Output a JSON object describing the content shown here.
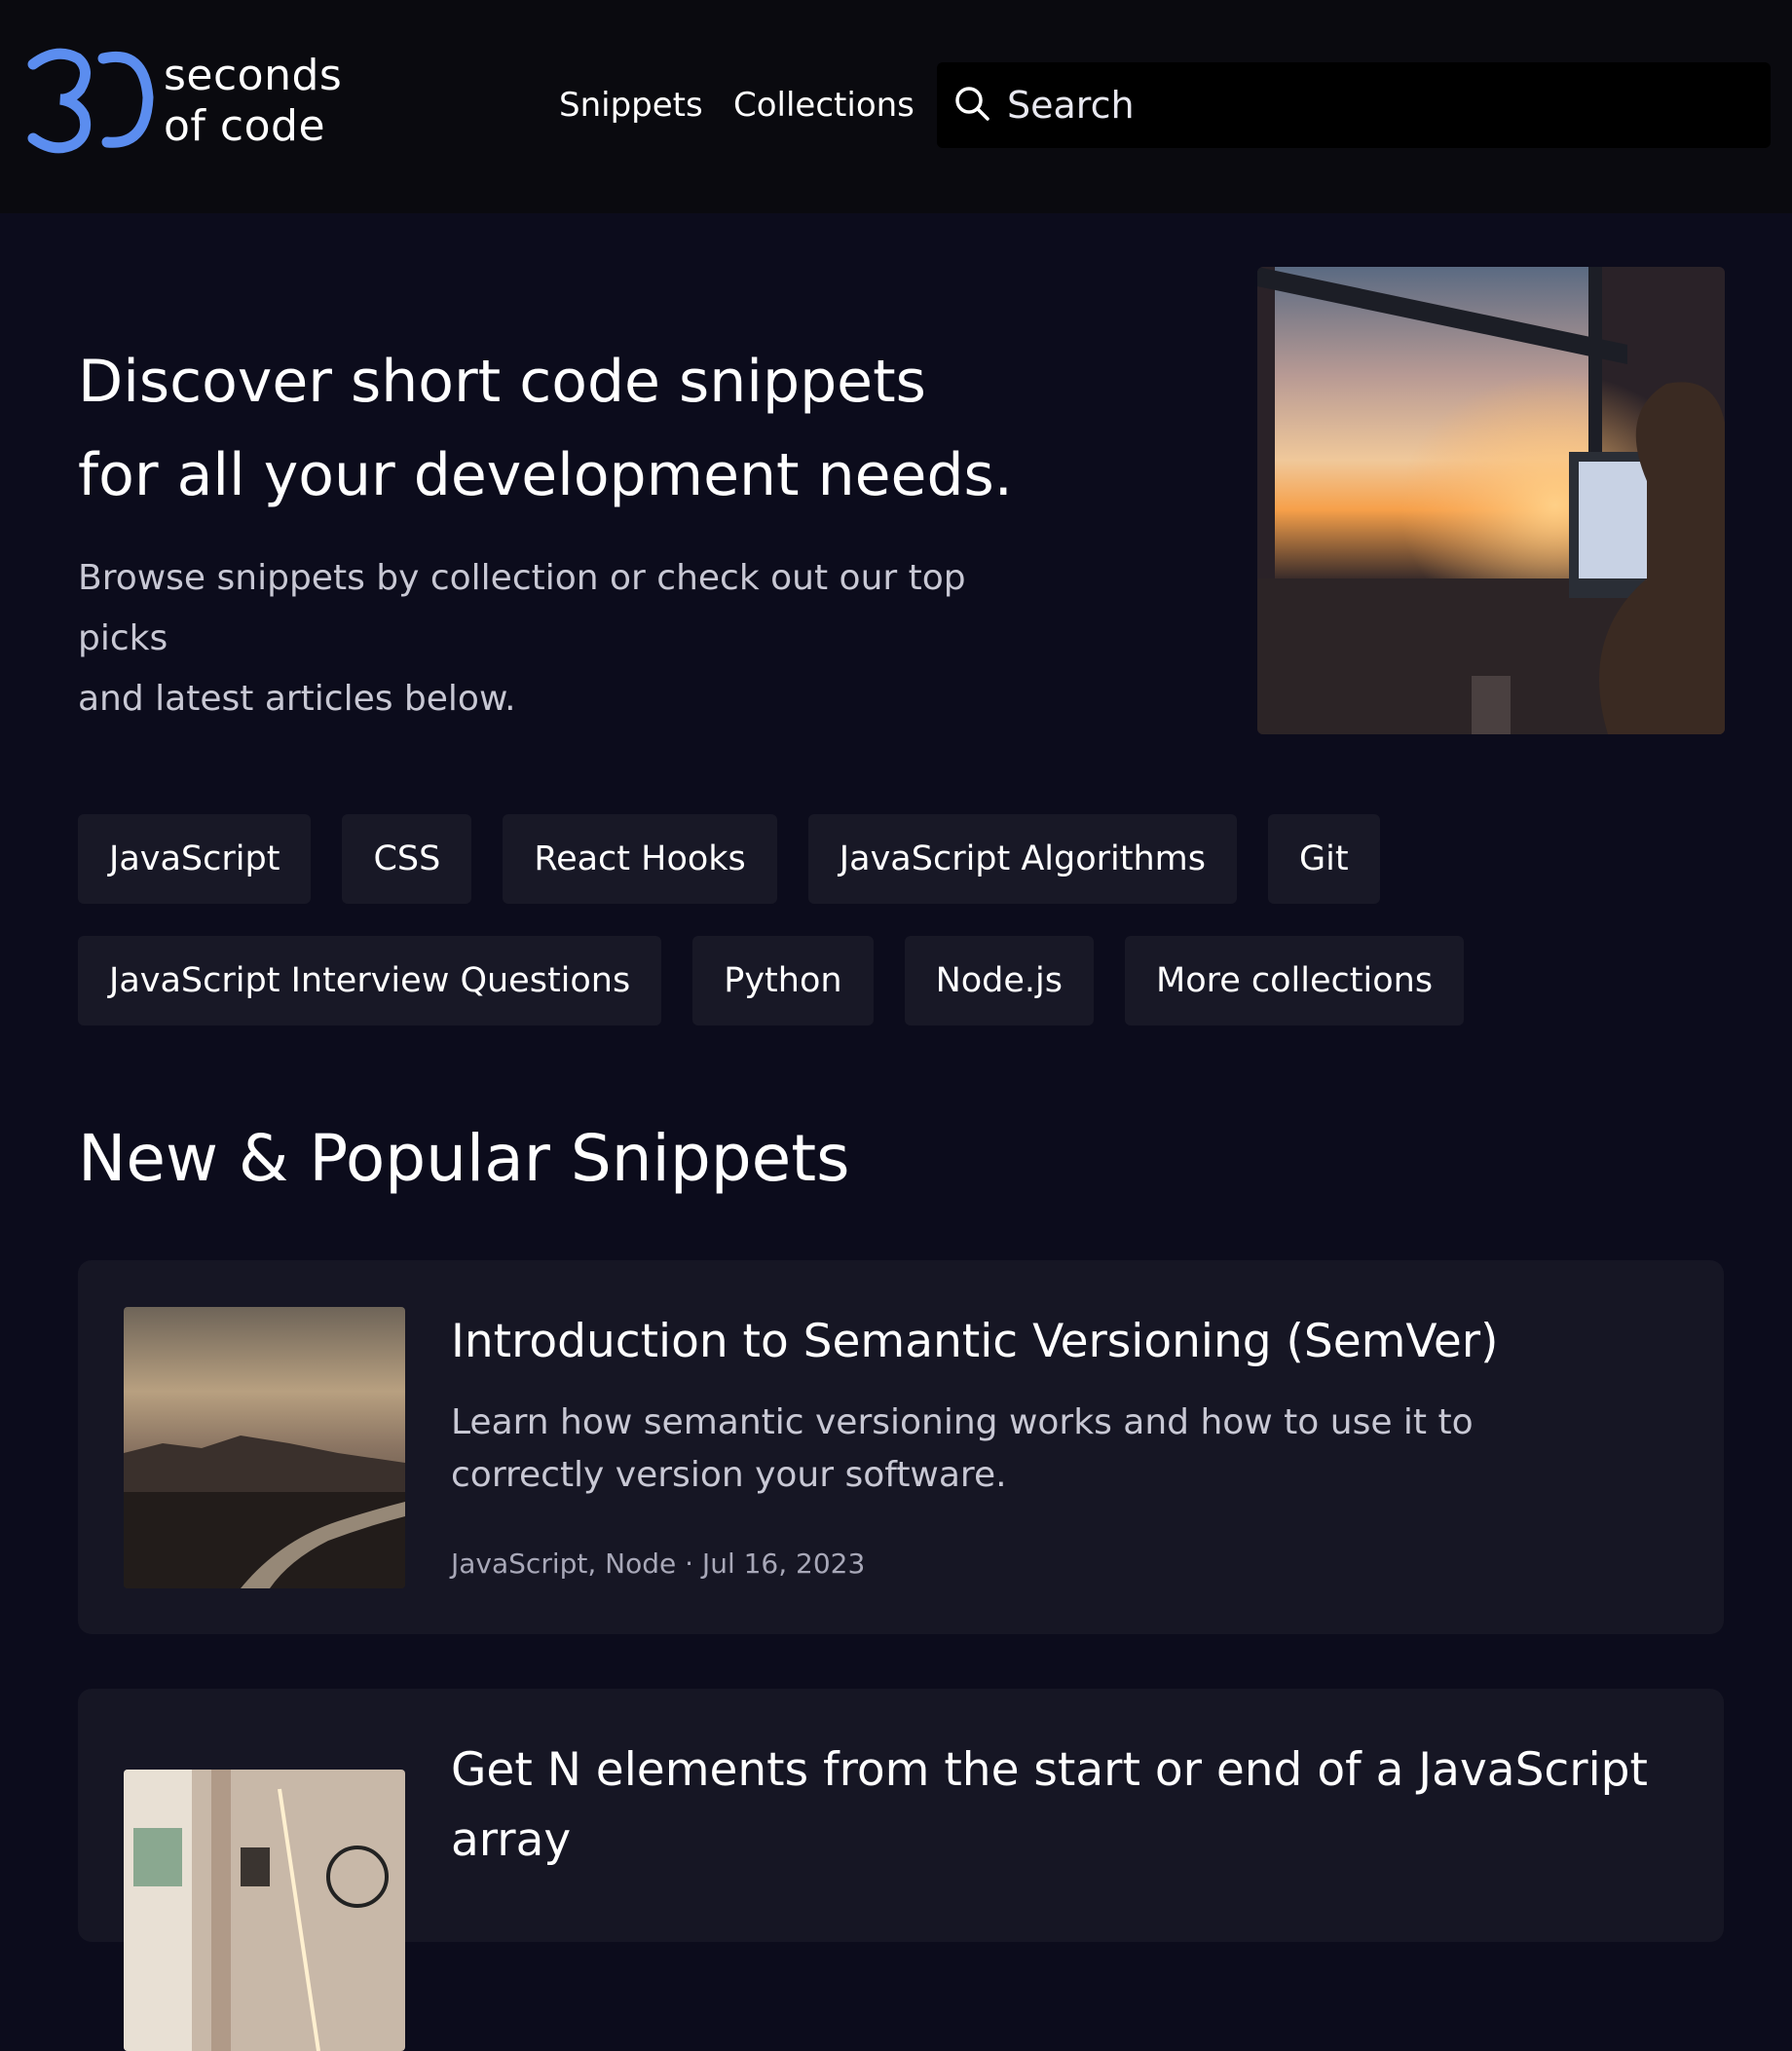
{
  "header": {
    "logo_line1": "seconds",
    "logo_line2": "of code",
    "nav": [
      "Snippets",
      "Collections"
    ],
    "search_placeholder": "Search"
  },
  "hero": {
    "title_line1": "Discover short code snippets",
    "title_line2": "for all your development needs.",
    "subtitle_line1": "Browse snippets by collection or check out our top picks",
    "subtitle_line2": "and latest articles below."
  },
  "collections": {
    "row1": [
      "JavaScript",
      "CSS",
      "React Hooks",
      "JavaScript Algorithms",
      "Git"
    ],
    "row2": [
      "JavaScript Interview Questions",
      "Python",
      "Node.js",
      "More collections"
    ]
  },
  "section": {
    "title": "New & Popular Snippets"
  },
  "snippets": [
    {
      "title": "Introduction to Semantic Versioning (SemVer)",
      "description": "Learn how semantic versioning works and how to use it to correctly version your software.",
      "meta": "JavaScript, Node · Jul 16, 2023"
    },
    {
      "title": "Get N elements from the start or end of a JavaScript array"
    }
  ],
  "colors": {
    "background": "#0c0c1c",
    "header": "#0a0a0f",
    "chip": "#181826",
    "card": "#161624",
    "logo_accent": "#5b8def"
  }
}
